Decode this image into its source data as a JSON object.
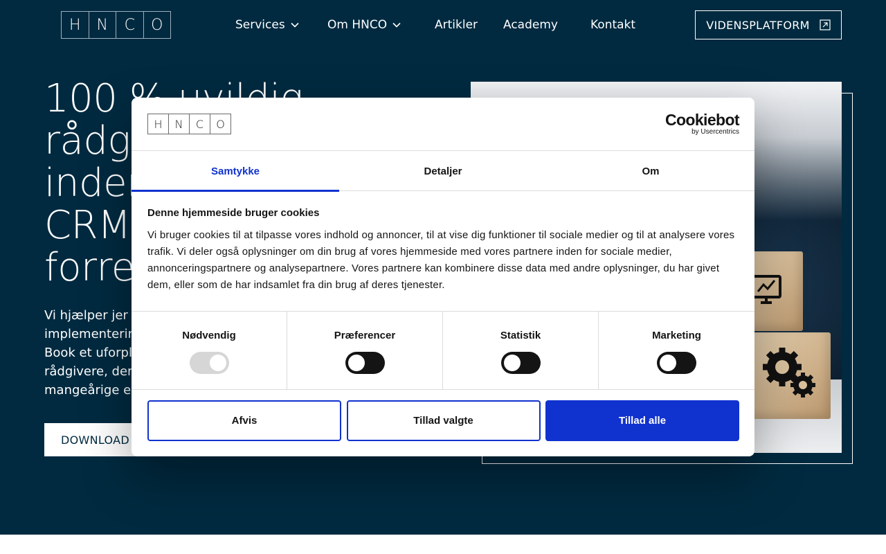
{
  "brand": {
    "letters": [
      "H",
      "N",
      "C",
      "O"
    ]
  },
  "nav": {
    "items": [
      {
        "label": "Services",
        "has_dropdown": true
      },
      {
        "label": "Om HNCO",
        "has_dropdown": true
      },
      {
        "label": "Artikler",
        "has_dropdown": false
      },
      {
        "label": "Academy",
        "has_dropdown": false
      },
      {
        "label": "Kontakt",
        "has_dropdown": false
      }
    ],
    "cta_label": "VIDENSPLATFORM",
    "cta_icon": "external-link-icon"
  },
  "hero": {
    "title": "100 % uvildig\nrådgivning\nindenfor\nCRM og\nforretning",
    "body": "Vi hjælper jer med\nimplementering\nBook et uforpligt\nrådgivere, der\nmangeårige er",
    "download_label": "DOWNLOAD",
    "colors": {
      "background": "#012a40",
      "accent": "#ffffff"
    }
  },
  "cookie": {
    "logo_letters": [
      "H",
      "N",
      "C",
      "O"
    ],
    "provider_name": "Cookiebot",
    "provider_sub": "by Usercentrics",
    "tabs": [
      {
        "label": "Samtykke",
        "active": true
      },
      {
        "label": "Detaljer",
        "active": false
      },
      {
        "label": "Om",
        "active": false
      }
    ],
    "heading": "Denne hjemmeside bruger cookies",
    "text": "Vi bruger cookies til at tilpasse vores indhold og annoncer, til at vise dig funktioner til sociale medier og til at analysere vores trafik. Vi deler også oplysninger om din brug af vores hjemmeside med vores partnere inden for sociale medier, annonceringspartnere og analysepartnere. Vores partnere kan kombinere disse data med andre oplysninger, du har givet dem, eller som de har indsamlet fra din brug af deres tjenester.",
    "categories": [
      {
        "label": "Nødvendig",
        "checked": true,
        "locked": true
      },
      {
        "label": "Præferencer",
        "checked": false,
        "locked": false
      },
      {
        "label": "Statistik",
        "checked": false,
        "locked": false
      },
      {
        "label": "Marketing",
        "checked": false,
        "locked": false
      }
    ],
    "buttons": {
      "deny": "Afvis",
      "allow_selected": "Tillad valgte",
      "allow_all": "Tillad alle"
    },
    "colors": {
      "primary": "#1032cf",
      "text": "#141414"
    }
  }
}
